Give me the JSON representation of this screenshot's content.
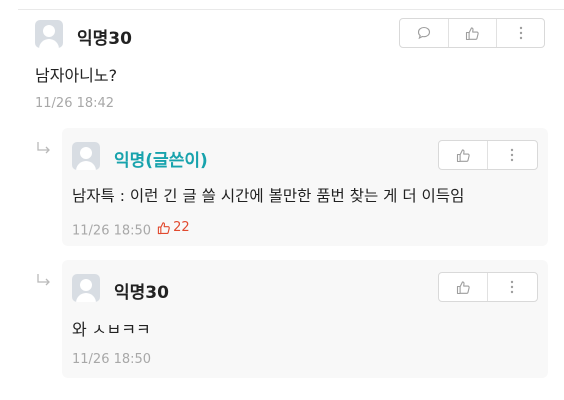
{
  "main_comment": {
    "author": "익명30",
    "text": "남자아니노?",
    "timestamp": "11/26 18:42",
    "actions": [
      "comment-icon",
      "thumbs-up-icon",
      "more-vertical-icon"
    ]
  },
  "replies": [
    {
      "author": "익명(글쓴이)",
      "is_writer": true,
      "text": "남자특 : 이런 긴 글 쓸 시간에 볼만한 품번 찾는 게 더 이득임",
      "timestamp": "11/26 18:50",
      "likes": "22",
      "actions": [
        "thumbs-up-icon",
        "more-vertical-icon"
      ]
    },
    {
      "author": "익명30",
      "is_writer": false,
      "text": "와 ㅅㅂㅋㅋ",
      "timestamp": "11/26 18:50",
      "actions": [
        "thumbs-up-icon",
        "more-vertical-icon"
      ]
    }
  ],
  "colors": {
    "writer_name": "#18a3ad",
    "like_count": "#e14a2f",
    "meta_text": "#a8a8a8",
    "reply_background": "#f8f8f8",
    "avatar_background": "#d8dde3"
  }
}
